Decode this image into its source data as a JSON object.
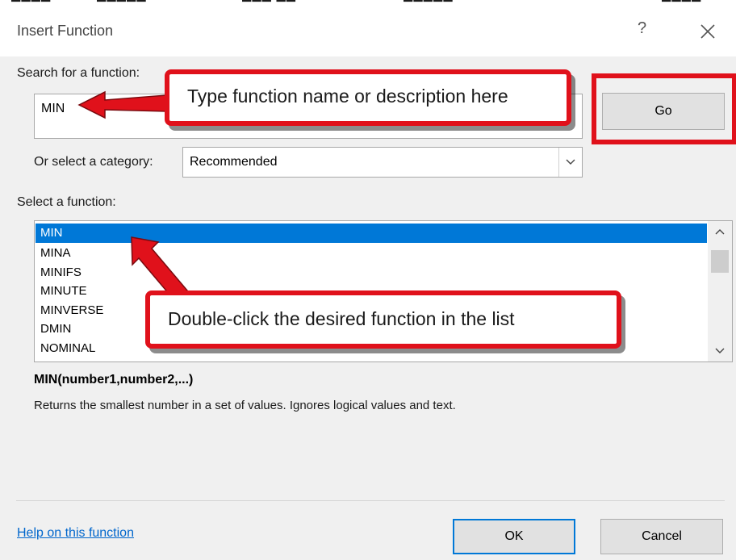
{
  "dialog": {
    "title": "Insert Function",
    "help_glyph": "?",
    "close_glyph": "✕"
  },
  "search": {
    "label": "Search for a function:",
    "value": "MIN",
    "go_label": "Go"
  },
  "category": {
    "label": "Or select a category:",
    "value": "Recommended"
  },
  "function_list": {
    "label": "Select a function:",
    "items": [
      "MIN",
      "MINA",
      "MINIFS",
      "MINUTE",
      "MINVERSE",
      "DMIN",
      "NOMINAL"
    ],
    "selected_index": 0
  },
  "details": {
    "signature": "MIN(number1,number2,...)",
    "description": "Returns the smallest number in a set of values. Ignores logical values and text."
  },
  "footer": {
    "help_link": "Help on this function",
    "ok_label": "OK",
    "cancel_label": "Cancel"
  },
  "annotations": {
    "callout_search": "Type function name or description here",
    "callout_list": "Double-click the desired function in the list",
    "highlight_color": "#e0111b"
  },
  "colors": {
    "selection": "#0078d7",
    "link": "#0066cc"
  }
}
